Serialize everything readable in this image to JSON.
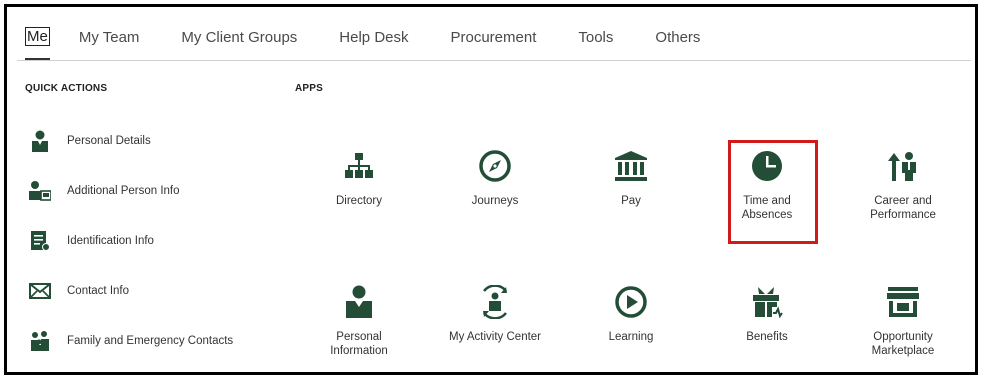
{
  "tabs": [
    "Me",
    "My Team",
    "My Client Groups",
    "Help Desk",
    "Procurement",
    "Tools",
    "Others"
  ],
  "quick_actions": {
    "title": "QUICK ACTIONS",
    "items": [
      {
        "label": "Personal Details",
        "icon": "person-icon"
      },
      {
        "label": "Additional Person Info",
        "icon": "person-card-icon"
      },
      {
        "label": "Identification Info",
        "icon": "id-document-icon"
      },
      {
        "label": "Contact Info",
        "icon": "envelope-icon"
      },
      {
        "label": "Family and Emergency Contacts",
        "icon": "family-icon"
      }
    ]
  },
  "apps": {
    "title": "APPS",
    "items": [
      {
        "label": "Directory",
        "icon": "org-chart-icon"
      },
      {
        "label": "Journeys",
        "icon": "compass-icon"
      },
      {
        "label": "Pay",
        "icon": "bank-icon"
      },
      {
        "label": "Time and Absences",
        "icon": "clock-icon"
      },
      {
        "label": "Career and Performance",
        "icon": "career-icon"
      },
      {
        "label": "Personal Information",
        "icon": "person-icon"
      },
      {
        "label": "My Activity Center",
        "icon": "activity-icon"
      },
      {
        "label": "Learning",
        "icon": "play-icon"
      },
      {
        "label": "Benefits",
        "icon": "gift-icon"
      },
      {
        "label": "Opportunity Marketplace",
        "icon": "store-icon"
      }
    ]
  },
  "colors": {
    "icon_green": "#234d36",
    "highlight": "#d11a1a"
  }
}
